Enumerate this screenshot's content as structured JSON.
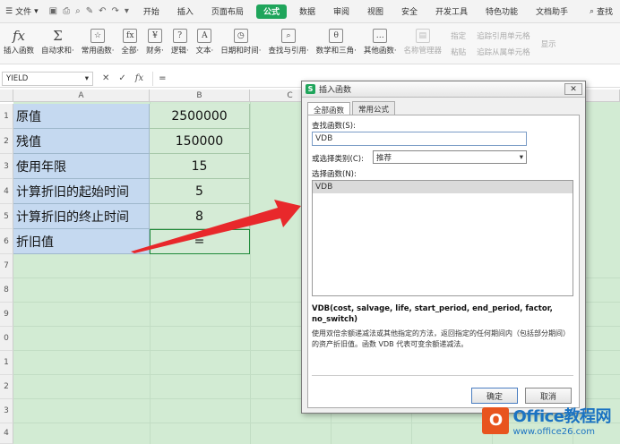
{
  "menubar": {
    "file_label": "文件",
    "tabs": [
      "开始",
      "插入",
      "页面布局",
      "公式",
      "数据",
      "审阅",
      "视图",
      "安全",
      "开发工具",
      "特色功能",
      "文档助手"
    ],
    "active_tab": "公式",
    "search_label": "查找"
  },
  "ribbon": {
    "insert_function": "插入函数",
    "autosum": "自动求和·",
    "recent": "常用函数·",
    "all": "全部·",
    "finance": "财务·",
    "logic": "逻辑·",
    "text": "文本·",
    "datetime": "日期和时间·",
    "lookup": "查找与引用·",
    "math": "数学和三角·",
    "other": "其他函数·",
    "name_manager": "名称管理器",
    "specify": "指定",
    "paste": "粘贴",
    "trace_precedents": "追踪引用单元格",
    "trace_dependents": "追踪从属单元格",
    "show": "显示"
  },
  "formula_bar": {
    "name_box": "YIELD",
    "formula": "="
  },
  "columns": [
    "A",
    "B",
    "C"
  ],
  "rows": [
    "1",
    "2",
    "3",
    "4",
    "5",
    "6",
    "7",
    "8",
    "9",
    "0",
    "1",
    "2",
    "3",
    "4"
  ],
  "table": [
    {
      "label": "原值",
      "value": "2500000"
    },
    {
      "label": "残值",
      "value": "150000"
    },
    {
      "label": "使用年限",
      "value": "15"
    },
    {
      "label": "计算折旧的起始时间",
      "value": "5"
    },
    {
      "label": "计算折旧的终止时间",
      "value": "8"
    },
    {
      "label": "折旧值",
      "value": "="
    }
  ],
  "dialog": {
    "title": "插入函数",
    "tab_all": "全部函数",
    "tab_common": "常用公式",
    "search_label": "查找函数(S):",
    "search_value": "VDB",
    "category_label": "或选择类别(C):",
    "category_value": "推荐",
    "select_label": "选择函数(N):",
    "list_items": [
      "VDB"
    ],
    "signature": "VDB(cost, salvage, life, start_period, end_period, factor, no_switch)",
    "description": "使用双倍余额递减法或其他指定的方法，返回指定的任何期间内（包括部分期间）的资产折旧值。函数 VDB 代表可变余额递减法。",
    "ok": "确定",
    "cancel": "取消"
  },
  "watermark": {
    "line1": "Office教程网",
    "line2": "www.office26.com"
  },
  "colors": {
    "accent": "#1fa55b",
    "arrow": "#e8282b"
  }
}
